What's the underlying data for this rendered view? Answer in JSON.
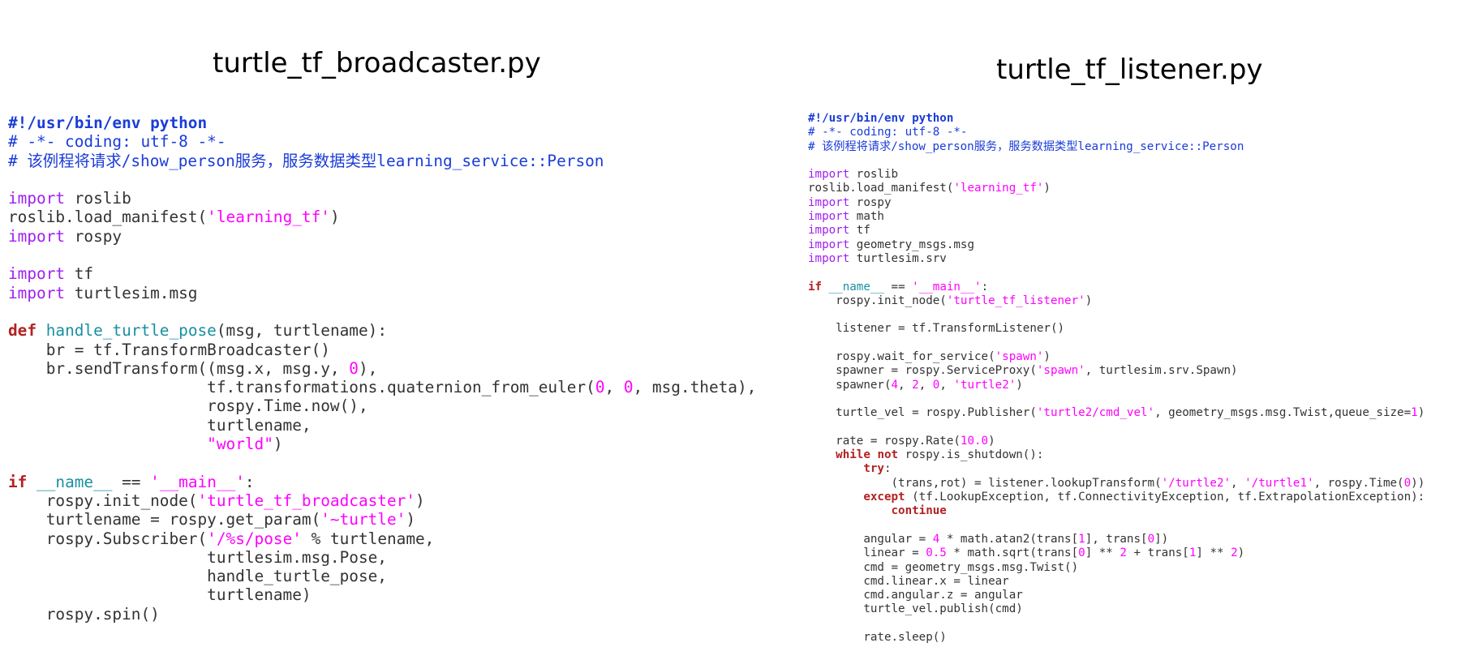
{
  "left": {
    "title": "turtle_tf_broadcaster.py",
    "code": [
      "#!/usr/bin/env python",
      "# -*- coding: utf-8 -*-",
      "# 该例程将请求/show_person服务，服务数据类型learning_service::Person",
      "",
      "import roslib",
      "roslib.load_manifest('learning_tf')",
      "import rospy",
      "",
      "import tf",
      "import turtlesim.msg",
      "",
      "def handle_turtle_pose(msg, turtlename):",
      "    br = tf.TransformBroadcaster()",
      "    br.sendTransform((msg.x, msg.y, 0),",
      "                     tf.transformations.quaternion_from_euler(0, 0, msg.theta),",
      "                     rospy.Time.now(),",
      "                     turtlename,",
      "                     \"world\")",
      "",
      "if __name__ == '__main__':",
      "    rospy.init_node('turtle_tf_broadcaster')",
      "    turtlename = rospy.get_param('~turtle')",
      "    rospy.Subscriber('/%s/pose' % turtlename,",
      "                     turtlesim.msg.Pose,",
      "                     handle_turtle_pose,",
      "                     turtlename)",
      "    rospy.spin()"
    ]
  },
  "right": {
    "title": "turtle_tf_listener.py",
    "code": [
      "#!/usr/bin/env python",
      "# -*- coding: utf-8 -*-",
      "# 该例程将请求/show_person服务，服务数据类型learning_service::Person",
      "",
      "import roslib",
      "roslib.load_manifest('learning_tf')",
      "import rospy",
      "import math",
      "import tf",
      "import geometry_msgs.msg",
      "import turtlesim.srv",
      "",
      "if __name__ == '__main__':",
      "    rospy.init_node('turtle_tf_listener')",
      "",
      "    listener = tf.TransformListener()",
      "",
      "    rospy.wait_for_service('spawn')",
      "    spawner = rospy.ServiceProxy('spawn', turtlesim.srv.Spawn)",
      "    spawner(4, 2, 0, 'turtle2')",
      "",
      "    turtle_vel = rospy.Publisher('turtle2/cmd_vel', geometry_msgs.msg.Twist,queue_size=1)",
      "",
      "    rate = rospy.Rate(10.0)",
      "    while not rospy.is_shutdown():",
      "        try:",
      "            (trans,rot) = listener.lookupTransform('/turtle2', '/turtle1', rospy.Time(0))",
      "        except (tf.LookupException, tf.ConnectivityException, tf.ExtrapolationException):",
      "            continue",
      "",
      "        angular = 4 * math.atan2(trans[1], trans[0])",
      "        linear = 0.5 * math.sqrt(trans[0] ** 2 + trans[1] ** 2)",
      "        cmd = geometry_msgs.msg.Twist()",
      "        cmd.linear.x = linear",
      "        cmd.angular.z = angular",
      "        turtle_vel.publish(cmd)",
      "",
      "        rate.sleep()"
    ]
  }
}
